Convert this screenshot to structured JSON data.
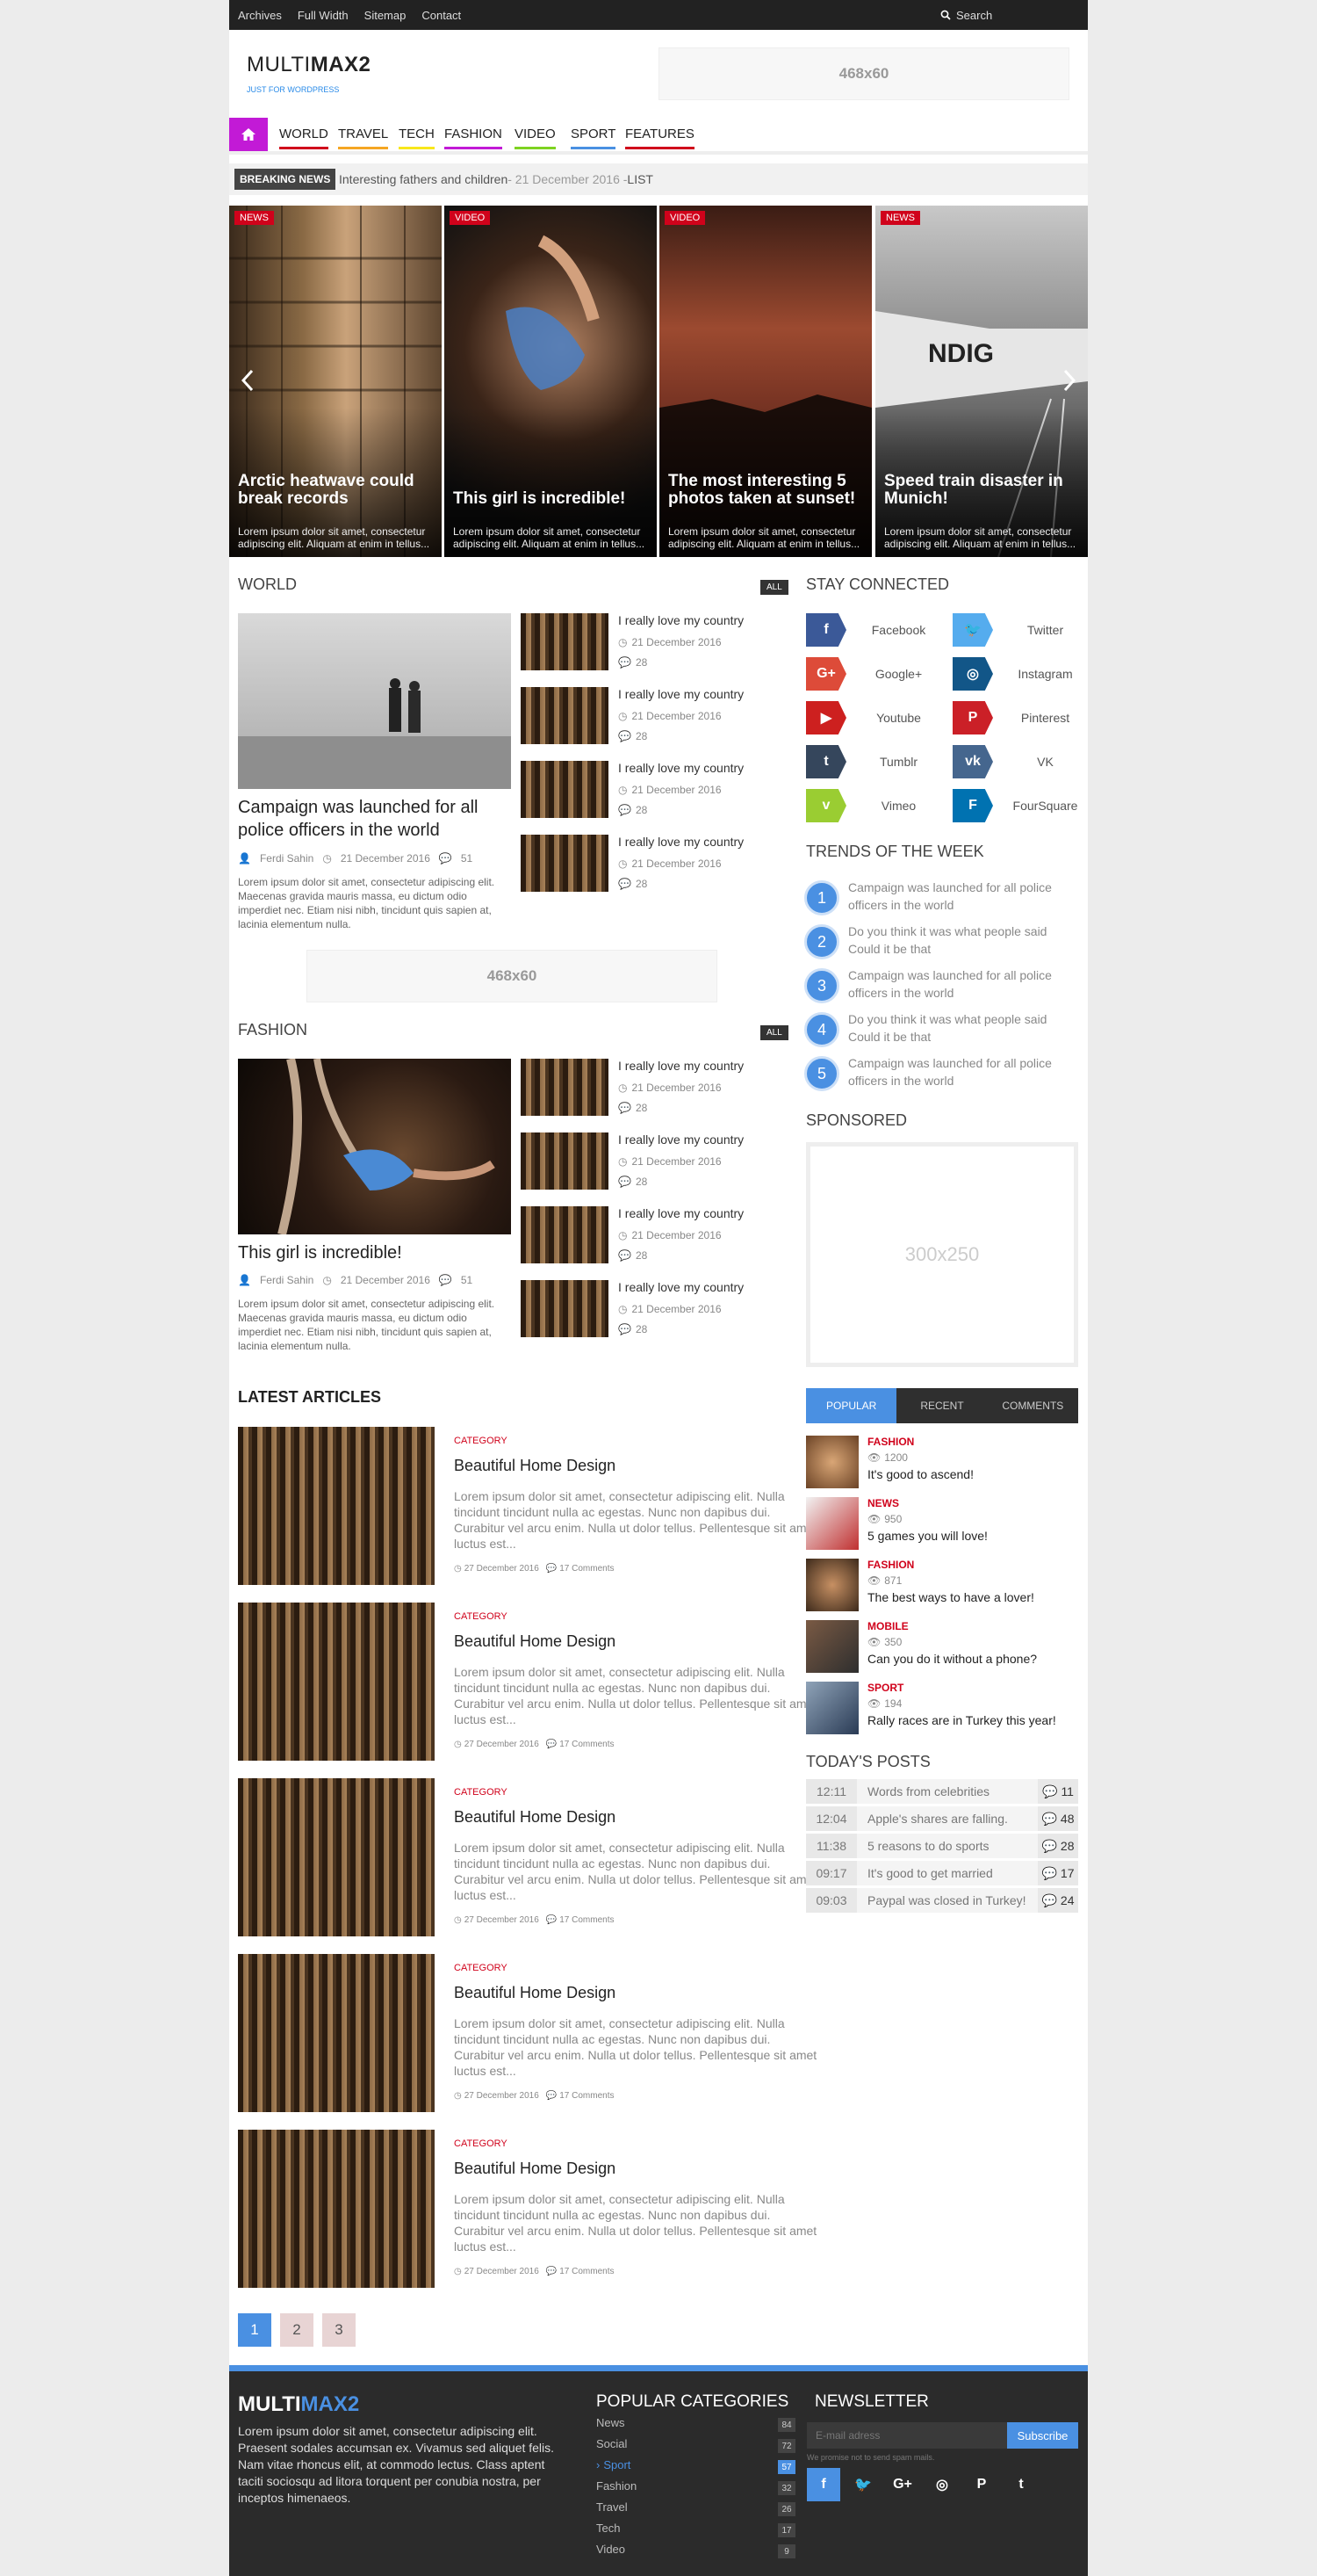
{
  "topbar": {
    "links": [
      "Archives",
      "Full Width",
      "Sitemap",
      "Contact"
    ],
    "search_label": "Search"
  },
  "header": {
    "logo_light": "MULTI",
    "logo_bold": "MAX2",
    "tagline": "JUST FOR WORDPRESS",
    "ad_label": "468x60"
  },
  "nav": {
    "items": [
      {
        "label": "WORLD",
        "color": "#d0021b"
      },
      {
        "label": "TRAVEL",
        "color": "#f5a623"
      },
      {
        "label": "TECH",
        "color": "#f8e71c"
      },
      {
        "label": "FASHION",
        "color": "#c21ad6"
      },
      {
        "label": "VIDEO",
        "color": "#7ed321"
      },
      {
        "label": "SPORT",
        "color": "#4a90e2"
      },
      {
        "label": "FEATURES",
        "color": "#d0021b"
      }
    ]
  },
  "breaking": {
    "label": "BREAKING NEWS",
    "title": "Interesting fathers and children",
    "date": " - 21 December 2016 - ",
    "category": "LIST"
  },
  "slider": [
    {
      "tag": "NEWS",
      "title": "Arctic heatwave could break records",
      "excerpt": "Lorem ipsum dolor sit amet, consectetur adipiscing elit. Aliquam at enim in tellus..."
    },
    {
      "tag": "VIDEO",
      "title": "This girl is incredible!",
      "excerpt": "Lorem ipsum dolor sit amet, consectetur adipiscing elit. Aliquam at enim in tellus..."
    },
    {
      "tag": "VIDEO",
      "title": "The most interesting 5 photos taken at sunset!",
      "excerpt": "Lorem ipsum dolor sit amet, consectetur adipiscing elit. Aliquam at enim in tellus..."
    },
    {
      "tag": "NEWS",
      "title": "Speed train disaster in Munich!",
      "excerpt": "Lorem ipsum dolor sit amet, consectetur adipiscing elit. Aliquam at enim in tellus..."
    }
  ],
  "world": {
    "heading": "WORLD",
    "all": "ALL",
    "main_title": "Campaign was launched for all police officers in the world",
    "author": "Ferdi Sahin",
    "date": "21 December 2016",
    "comments": "51",
    "excerpt": "Lorem ipsum dolor sit amet, consectetur adipiscing elit. Maecenas gravida mauris massa, eu dictum odio imperdiet nec. Etiam nisi nibh, tincidunt quis sapien at, lacinia elementum nulla.",
    "items": [
      {
        "title": "I really love my country",
        "date": "21 December 2016",
        "comments": "28"
      },
      {
        "title": "I really love my country",
        "date": "21 December 2016",
        "comments": "28"
      },
      {
        "title": "I really love my country",
        "date": "21 December 2016",
        "comments": "28"
      },
      {
        "title": "I really love my country",
        "date": "21 December 2016",
        "comments": "28"
      }
    ]
  },
  "mid_ad": "468x60",
  "fashion": {
    "heading": "FASHION",
    "all": "ALL",
    "main_title": "This girl is incredible!",
    "author": "Ferdi Sahin",
    "date": "21 December 2016",
    "comments": "51",
    "excerpt": "Lorem ipsum dolor sit amet, consectetur adipiscing elit. Maecenas gravida mauris massa, eu dictum odio imperdiet nec. Etiam nisi nibh, tincidunt quis sapien at, lacinia elementum nulla.",
    "items": [
      {
        "title": "I really love my country",
        "date": "21 December 2016",
        "comments": "28"
      },
      {
        "title": "I really love my country",
        "date": "21 December 2016",
        "comments": "28"
      },
      {
        "title": "I really love my country",
        "date": "21 December 2016",
        "comments": "28"
      },
      {
        "title": "I really love my country",
        "date": "21 December 2016",
        "comments": "28"
      }
    ]
  },
  "latest": {
    "heading": "LATEST ARTICLES",
    "articles": [
      {
        "category": "CATEGORY",
        "title": "Beautiful Home Design",
        "excerpt": "Lorem ipsum dolor sit amet, consectetur adipiscing elit. Nulla tincidunt tincidunt nulla ac egestas. Nunc non dapibus dui. Curabitur vel arcu enim. Nulla ut dolor tellus. Pellentesque sit amet luctus est...",
        "date": "27 December 2016",
        "comments": "17 Comments"
      },
      {
        "category": "CATEGORY",
        "title": "Beautiful Home Design",
        "excerpt": "Lorem ipsum dolor sit amet, consectetur adipiscing elit. Nulla tincidunt tincidunt nulla ac egestas. Nunc non dapibus dui. Curabitur vel arcu enim. Nulla ut dolor tellus. Pellentesque sit amet luctus est...",
        "date": "27 December 2016",
        "comments": "17 Comments"
      },
      {
        "category": "CATEGORY",
        "title": "Beautiful Home Design",
        "excerpt": "Lorem ipsum dolor sit amet, consectetur adipiscing elit. Nulla tincidunt tincidunt nulla ac egestas. Nunc non dapibus dui. Curabitur vel arcu enim. Nulla ut dolor tellus. Pellentesque sit amet luctus est...",
        "date": "27 December 2016",
        "comments": "17 Comments"
      },
      {
        "category": "CATEGORY",
        "title": "Beautiful Home Design",
        "excerpt": "Lorem ipsum dolor sit amet, consectetur adipiscing elit. Nulla tincidunt tincidunt nulla ac egestas. Nunc non dapibus dui. Curabitur vel arcu enim. Nulla ut dolor tellus. Pellentesque sit amet luctus est...",
        "date": "27 December 2016",
        "comments": "17 Comments"
      },
      {
        "category": "CATEGORY",
        "title": "Beautiful Home Design",
        "excerpt": "Lorem ipsum dolor sit amet, consectetur adipiscing elit. Nulla tincidunt tincidunt nulla ac egestas. Nunc non dapibus dui. Curabitur vel arcu enim. Nulla ut dolor tellus. Pellentesque sit amet luctus est...",
        "date": "27 December 2016",
        "comments": "17 Comments"
      }
    ],
    "pages": [
      "1",
      "2",
      "3"
    ]
  },
  "sidebar": {
    "stay_connected": "STAY CONNECTED",
    "social": [
      {
        "name": "Facebook",
        "icon": "facebook-icon",
        "glyph": "f",
        "color": "#3b5998"
      },
      {
        "name": "Twitter",
        "icon": "twitter-icon",
        "glyph": "🐦",
        "color": "#55acee"
      },
      {
        "name": "Google+",
        "icon": "google-plus-icon",
        "glyph": "G+",
        "color": "#dd4b39"
      },
      {
        "name": "Instagram",
        "icon": "instagram-icon",
        "glyph": "◎",
        "color": "#125688"
      },
      {
        "name": "Youtube",
        "icon": "youtube-icon",
        "glyph": "▶",
        "color": "#cd201f"
      },
      {
        "name": "Pinterest",
        "icon": "pinterest-icon",
        "glyph": "P",
        "color": "#cb2027"
      },
      {
        "name": "Tumblr",
        "icon": "tumblr-icon",
        "glyph": "t",
        "color": "#35465c"
      },
      {
        "name": "VK",
        "icon": "vk-icon",
        "glyph": "vk",
        "color": "#45668e"
      },
      {
        "name": "Vimeo",
        "icon": "vimeo-icon",
        "glyph": "v",
        "color": "#9acd32"
      },
      {
        "name": "FourSquare",
        "icon": "foursquare-icon",
        "glyph": "F",
        "color": "#0072b1"
      }
    ],
    "trends_heading": "TRENDS OF THE WEEK",
    "trends": [
      {
        "n": "1",
        "title": "Campaign was launched for all police officers in the world"
      },
      {
        "n": "2",
        "title": "Do you think it was what people said Could it be that"
      },
      {
        "n": "3",
        "title": "Campaign was launched for all police officers in the world"
      },
      {
        "n": "4",
        "title": "Do you think it was what people said Could it be that"
      },
      {
        "n": "5",
        "title": "Campaign was launched for all police officers in the world"
      }
    ],
    "sponsored_heading": "SPONSORED",
    "sponsored_ad": "300x250",
    "tabs": [
      "POPULAR",
      "RECENT",
      "COMMENTS"
    ],
    "popular": [
      {
        "category": "FASHION",
        "views": "1200",
        "title": "It's good to ascend!"
      },
      {
        "category": "NEWS",
        "views": "950",
        "title": "5 games you will love!"
      },
      {
        "category": "FASHION",
        "views": "871",
        "title": "The best ways to have a lover!"
      },
      {
        "category": "MOBILE",
        "views": "350",
        "title": "Can you do it without a phone?"
      },
      {
        "category": "SPORT",
        "views": "194",
        "title": "Rally races are in Turkey this year!"
      }
    ],
    "todays_heading": "TODAY'S POSTS",
    "todays": [
      {
        "time": "12:11",
        "title": "Words from celebrities",
        "comments": "11"
      },
      {
        "time": "12:04",
        "title": "Apple's shares are falling.",
        "comments": "48"
      },
      {
        "time": "11:38",
        "title": "5 reasons to do sports",
        "comments": "28"
      },
      {
        "time": "09:17",
        "title": "It's good to get married",
        "comments": "17"
      },
      {
        "time": "09:03",
        "title": "Paypal was closed in Turkey!",
        "comments": "24"
      }
    ]
  },
  "footer": {
    "logo_a": "MULTI",
    "logo_b": "MAX2",
    "about": "Lorem ipsum dolor sit amet, consectetur adipiscing elit. Praesent sodales accumsan ex. Vivamus sed aliquet felis. Nam vitae rhoncus elit, at commodo lectus. Class aptent taciti sociosqu ad litora torquent per conubia nostra, per inceptos himenaeos.",
    "categories_heading": "POPULAR CATEGORIES",
    "categories": [
      {
        "name": "News",
        "count": "84"
      },
      {
        "name": "Social",
        "count": "72"
      },
      {
        "name": "Sport",
        "count": "57",
        "active": true
      },
      {
        "name": "Fashion",
        "count": "32"
      },
      {
        "name": "Travel",
        "count": "26"
      },
      {
        "name": "Tech",
        "count": "17"
      },
      {
        "name": "Video",
        "count": "9"
      }
    ],
    "newsletter_heading": "NEWSLETTER",
    "newsletter_placeholder": "E-mail adress",
    "subscribe": "Subscribe",
    "newsletter_note": "We promise not to send spam mails.",
    "social_icons": [
      "facebook-icon",
      "twitter-icon",
      "google-plus-icon",
      "instagram-icon",
      "pinterest-icon",
      "tumblr-icon"
    ],
    "social_glyphs": [
      "f",
      "🐦",
      "G+",
      "◎",
      "P",
      "t"
    ]
  }
}
